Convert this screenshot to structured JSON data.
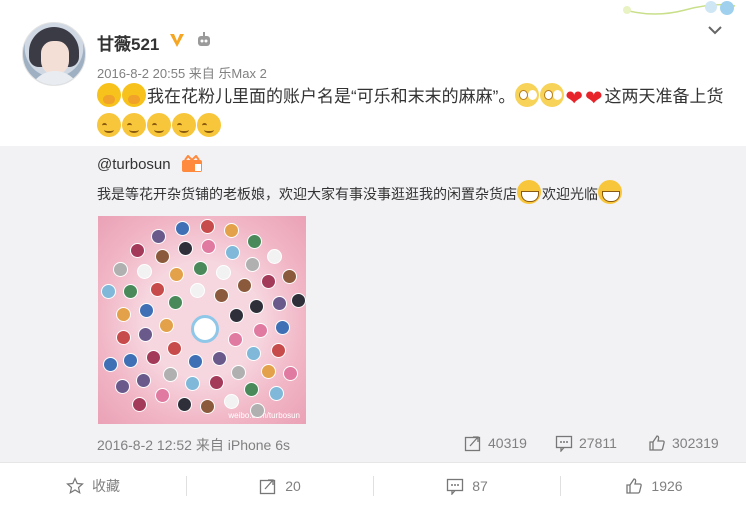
{
  "post": {
    "author": "甘薇521",
    "meta": "2016-8-2 20:55 来自 乐Max 2",
    "text_a": "我在花粉儿里面的账户名是“可乐和末末的麻麻”。",
    "text_b": "这两天准备上货"
  },
  "repost": {
    "author": "@turbosun",
    "text_a": "我是等花开杂货铺的老板娘，欢迎大家有事没事逛逛我的闲置杂货店",
    "text_b": "欢迎光临",
    "image_watermark": "weibo.com/turbosun",
    "meta": "2016-8-2 12:52 来自 iPhone 6s",
    "shares": "40319",
    "comments": "27811",
    "likes": "302319"
  },
  "actions": {
    "favorite": "收藏",
    "shares": "20",
    "comments": "87",
    "likes": "1926"
  },
  "colors": {
    "vip_badge": "#f5a623",
    "heart": "#e8242b",
    "repost_bg": "#f2f2f5",
    "meta_text": "#808080"
  }
}
